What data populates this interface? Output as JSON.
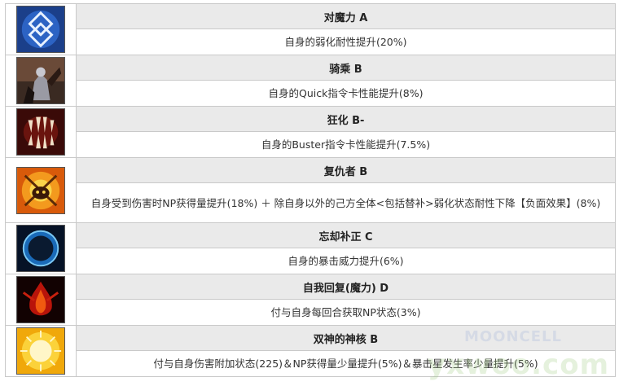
{
  "skills": [
    {
      "name": "对魔力 A",
      "desc": "自身的弱化耐性提升(20%)",
      "icon": "magic-resistance-icon"
    },
    {
      "name": "骑乘 B",
      "desc": "自身的Quick指令卡性能提升(8%)",
      "icon": "riding-icon"
    },
    {
      "name": "狂化 B-",
      "desc": "自身的Buster指令卡性能提升(7.5%)",
      "icon": "mad-enhancement-icon"
    },
    {
      "name": "复仇者 B",
      "desc": "自身受到伤害时NP获得量提升(18%) ＋ 除自身以外的己方全体<包括替补>弱化状态耐性下降【负面效果】(8%)",
      "icon": "avenger-icon"
    },
    {
      "name": "忘却补正 C",
      "desc": "自身的暴击威力提升(6%)",
      "icon": "oblivion-correction-icon"
    },
    {
      "name": "自我回复(魔力) D",
      "desc": "付与自身每回合获取NP状态(3%)",
      "icon": "self-replenishment-icon"
    },
    {
      "name": "双神的神核 B",
      "desc": "付与自身伤害附加状态(225)＆NP获得量少量提升(5%)＆暴击星发生率少量提升(5%)",
      "icon": "divine-core-icon"
    }
  ],
  "watermarks": {
    "mooncell": "MOONCELL",
    "site": "yxwoo.com"
  }
}
